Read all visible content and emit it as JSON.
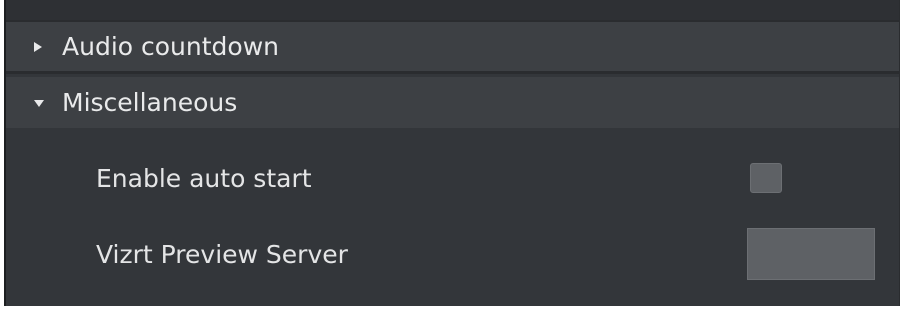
{
  "sections": {
    "audio_countdown": {
      "label": "Audio countdown",
      "state": "collapsed",
      "icon": "triangle-right-icon"
    },
    "miscellaneous": {
      "label": "Miscellaneous",
      "state": "expanded",
      "icon": "triangle-down-icon"
    }
  },
  "settings": {
    "enable_auto_start": {
      "label": "Enable auto start",
      "checked": false
    },
    "vizrt_preview_server": {
      "label": "Vizrt Preview Server",
      "value": ""
    }
  },
  "colors": {
    "panel_background": "#33363a",
    "header_background": "#3d4044",
    "control_background": "#5e6165",
    "text": "#e9eaeb"
  }
}
